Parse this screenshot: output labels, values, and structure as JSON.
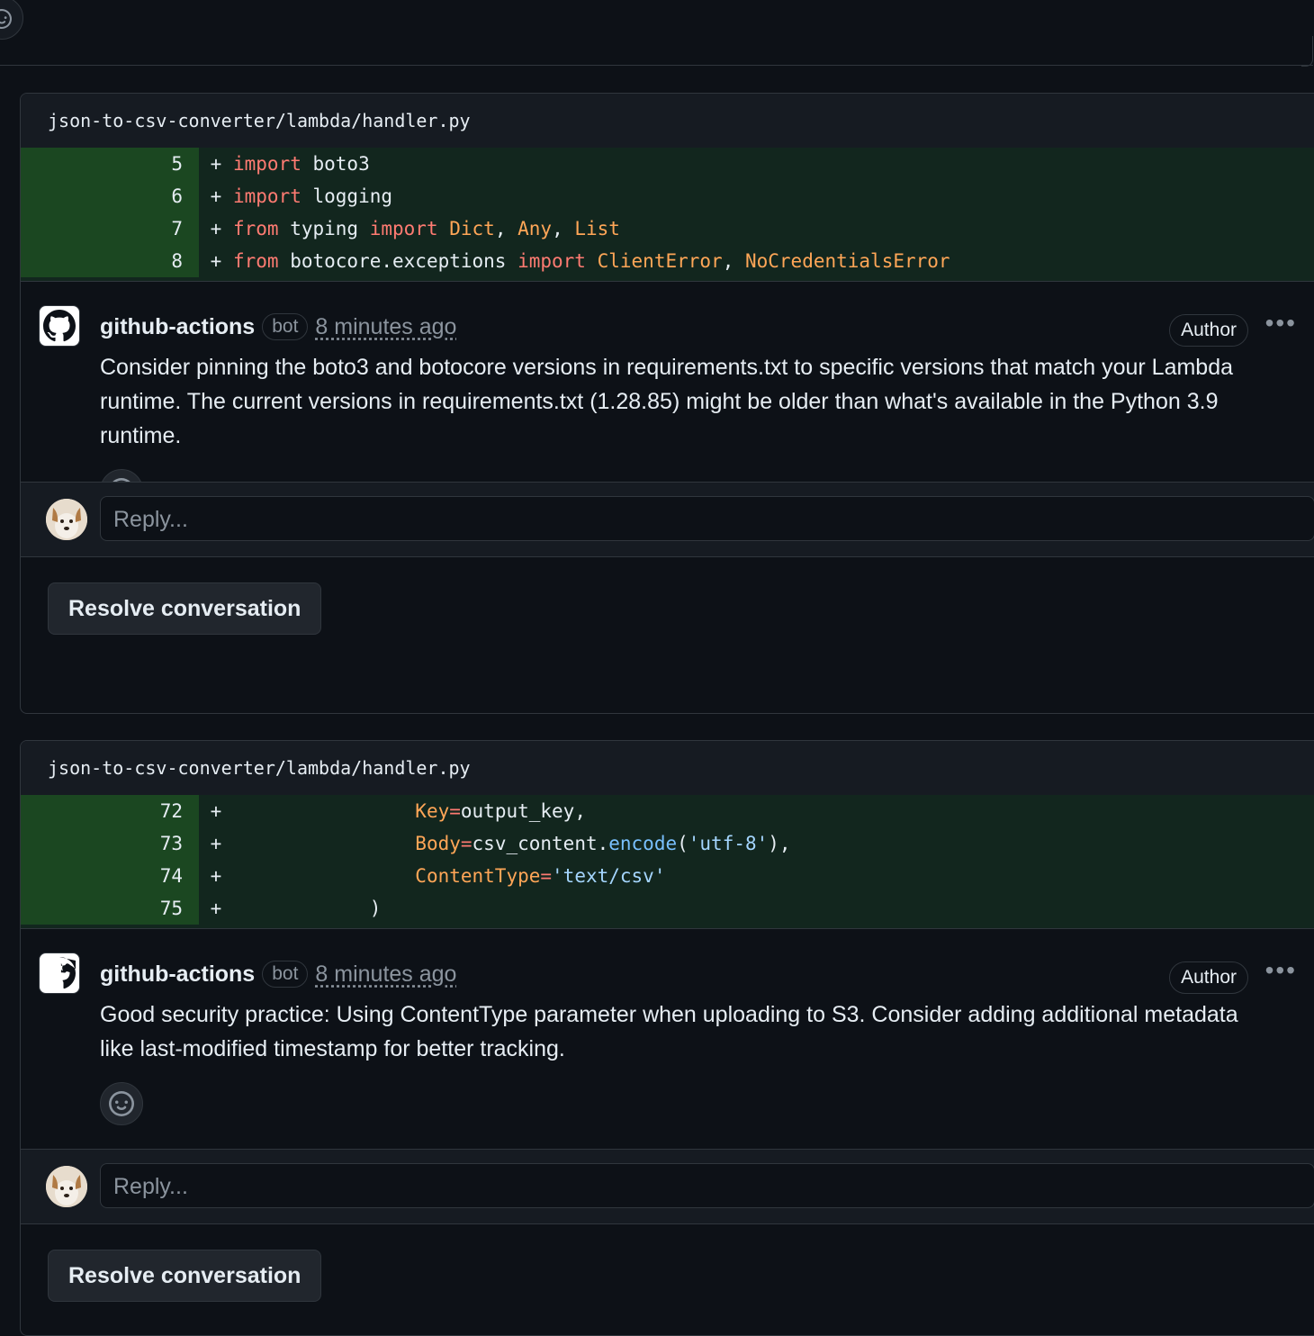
{
  "threads": [
    {
      "file_path": "json-to-csv-converter/lambda/handler.py",
      "lines": [
        {
          "num": "5",
          "prefix": "+"
        },
        {
          "num": "6",
          "prefix": "+"
        },
        {
          "num": "7",
          "prefix": "+"
        },
        {
          "num": "8",
          "prefix": "+"
        }
      ],
      "comment": {
        "author": "github-actions",
        "badge": "bot",
        "time": "8 minutes ago",
        "role": "Author",
        "body": "Consider pinning the boto3 and botocore versions in requirements.txt to specific versions that match your Lambda runtime. The current versions in requirements.txt (1.28.85) might be older than what's available in the Python 3.9 runtime."
      },
      "reply_placeholder": "Reply...",
      "resolve_label": "Resolve conversation"
    },
    {
      "file_path": "json-to-csv-converter/lambda/handler.py",
      "lines": [
        {
          "num": "72",
          "prefix": "+"
        },
        {
          "num": "73",
          "prefix": "+"
        },
        {
          "num": "74",
          "prefix": "+"
        },
        {
          "num": "75",
          "prefix": "+"
        }
      ],
      "comment": {
        "author": "github-actions",
        "badge": "bot",
        "time": "8 minutes ago",
        "role": "Author",
        "body": "Good security practice: Using ContentType parameter when uploading to S3. Consider adding additional metadata like last-modified timestamp for better tracking."
      },
      "reply_placeholder": "Reply...",
      "resolve_label": "Resolve conversation"
    }
  ],
  "code_tokens": {
    "t1_l5": [
      "import",
      " boto3"
    ],
    "t1_l6": [
      "import",
      " logging"
    ],
    "t1_l7": [
      "from",
      " typing ",
      "import",
      " ",
      "Dict",
      ", ",
      "Any",
      ", ",
      "List"
    ],
    "t1_l8": [
      "from",
      " botocore.exceptions ",
      "import",
      " ",
      "ClientError",
      ", ",
      "NoCredentialsError"
    ],
    "t2_l72": [
      "                ",
      "Key",
      "=",
      "output_key,"
    ],
    "t2_l73": [
      "                ",
      "Body",
      "=",
      "csv_content.",
      "encode",
      "(",
      "'utf-8'",
      "),"
    ],
    "t2_l74": [
      "                ",
      "ContentType",
      "=",
      "'text/csv'"
    ],
    "t2_l75": [
      "            )"
    ]
  },
  "icons": {
    "reaction": "smiley-icon",
    "bot_avatar": "github-mark-icon",
    "menu": "kebab-horizontal-icon"
  },
  "colors": {
    "background": "#0d1117",
    "diff_add_bg": "#12261e",
    "diff_add_num_bg": "#1b4721",
    "keyword": "#ff7b72",
    "class": "#ffa657",
    "string": "#a5d6ff",
    "function": "#79c0ff"
  }
}
